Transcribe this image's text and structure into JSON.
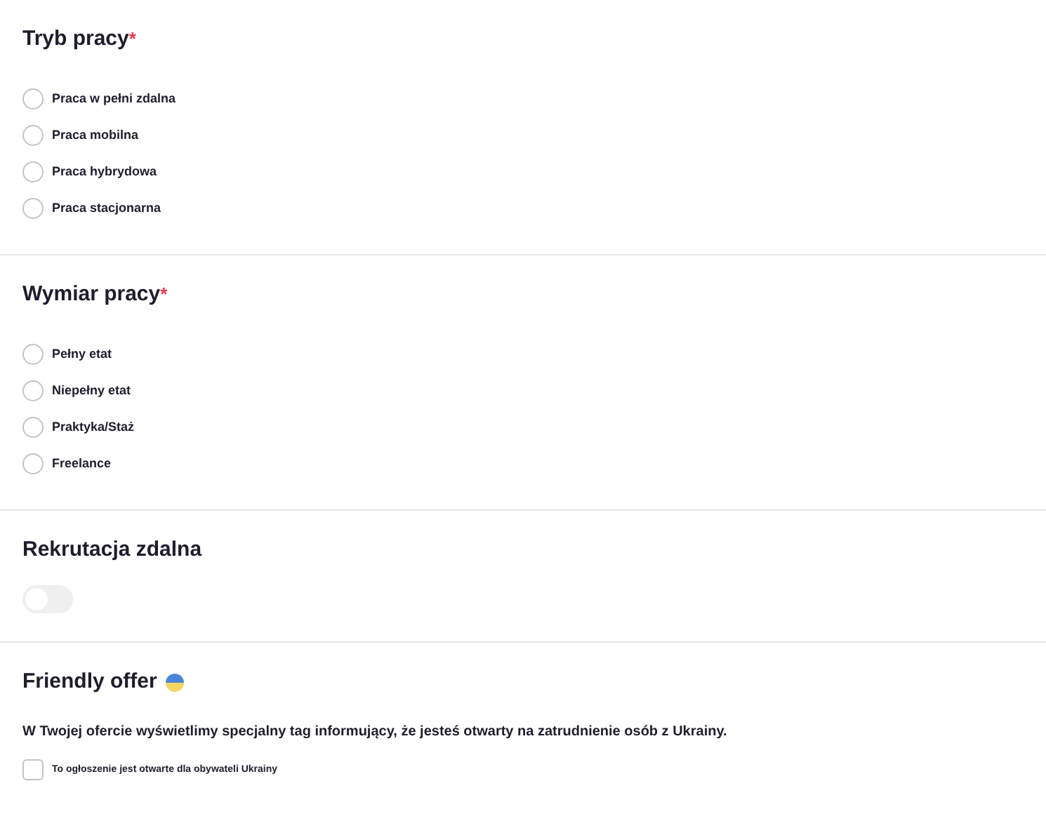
{
  "sections": [
    {
      "kind": "radio_group",
      "title": "Tryb pracy",
      "required_mark": "*",
      "options": [
        {
          "label": "Praca w pełni zdalna",
          "selected": false
        },
        {
          "label": "Praca mobilna",
          "selected": false
        },
        {
          "label": "Praca hybrydowa",
          "selected": false
        },
        {
          "label": "Praca stacjonarna",
          "selected": false
        }
      ]
    },
    {
      "kind": "radio_group",
      "title": "Wymiar pracy",
      "required_mark": "*",
      "options": [
        {
          "label": "Pełny etat",
          "selected": false
        },
        {
          "label": "Niepełny etat",
          "selected": false
        },
        {
          "label": "Praktyka/Staż",
          "selected": false
        },
        {
          "label": "Freelance",
          "selected": false
        }
      ]
    },
    {
      "kind": "toggle",
      "title": "Rekrutacja zdalna",
      "on": false
    },
    {
      "kind": "friendly",
      "title": "Friendly offer",
      "description": "W Twojej ofercie wyświetlimy specjalny tag informujący, że jesteś otwarty na zatrudnienie osób z Ukrainy.",
      "checkbox": {
        "label": "To ogłoszenie jest otwarte dla obywateli Ukrainy",
        "checked": false
      }
    }
  ]
}
